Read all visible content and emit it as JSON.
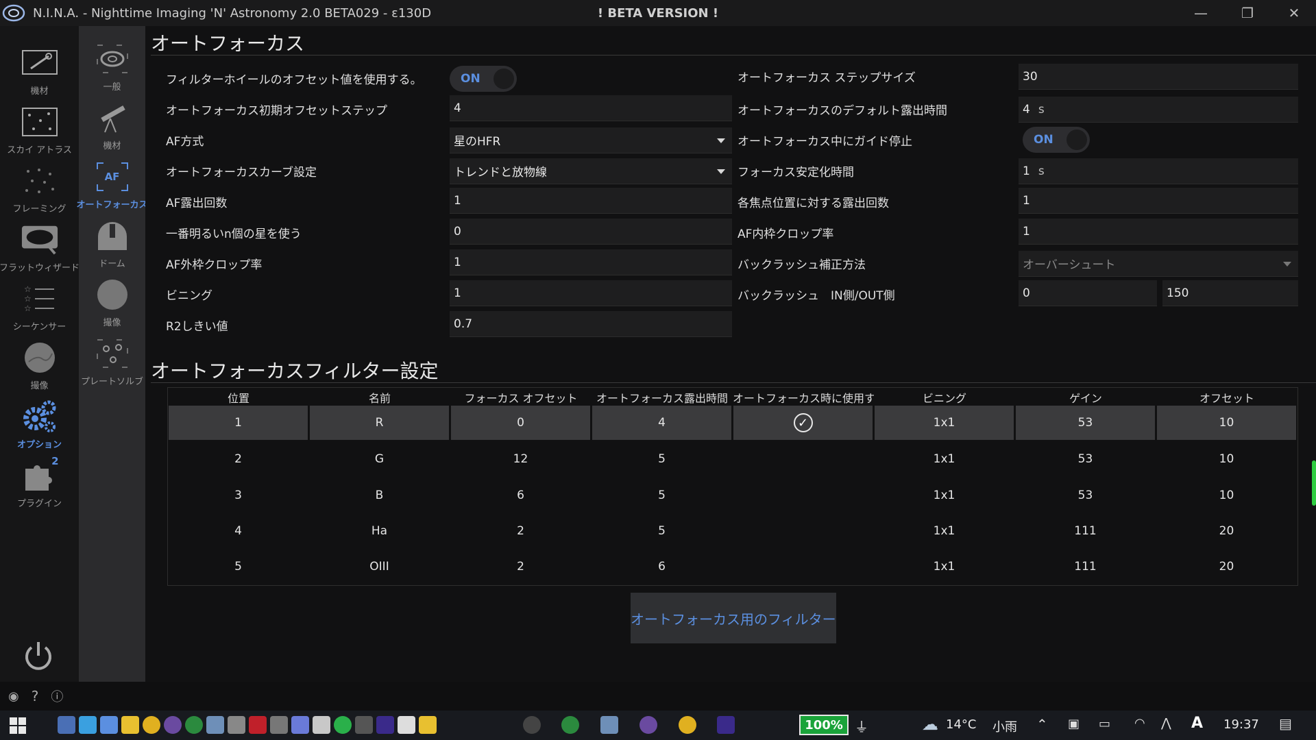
{
  "window": {
    "title": "N.I.N.A. - Nighttime Imaging 'N' Astronomy 2.0 BETA029  -  ε130D",
    "beta_banner": "! BETA VERSION !",
    "minimize": "—",
    "maximize": "❐",
    "close": "✕"
  },
  "nav_primary": [
    {
      "label": "機材",
      "icon": "camera-connect-icon"
    },
    {
      "label": "スカイ アトラス",
      "icon": "sky-atlas-icon"
    },
    {
      "label": "フレーミング",
      "icon": "framing-icon"
    },
    {
      "label": "フラットウィザード",
      "icon": "flat-wizard-icon"
    },
    {
      "label": "シーケンサー",
      "icon": "sequencer-icon"
    },
    {
      "label": "撮像",
      "icon": "imaging-icon"
    },
    {
      "label": "オプション",
      "icon": "gears-icon"
    },
    {
      "label": "プラグイン",
      "icon": "puzzle-icon",
      "badge": "2"
    }
  ],
  "nav_secondary": [
    {
      "label": "一般",
      "icon": "galaxy-icon"
    },
    {
      "label": "機材",
      "icon": "telescope-icon"
    },
    {
      "label": "オートフォーカス",
      "icon": "autofocus-icon",
      "icon_text": "AF"
    },
    {
      "label": "ドーム",
      "icon": "dome-icon"
    },
    {
      "label": "撮像",
      "icon": "imaging-icon"
    },
    {
      "label": "プレートソルブ",
      "icon": "plate-solve-icon"
    }
  ],
  "autofocus": {
    "title": "オートフォーカス",
    "left": {
      "use_filter_offsets_label": "フィルターホイールのオフセット値を使用する。",
      "use_filter_offsets_value": "ON",
      "initial_offset_label": "オートフォーカス初期オフセットステップ",
      "initial_offset_value": "4",
      "method_label": "AF方式",
      "method_value": "星のHFR",
      "curve_label": "オートフォーカスカーブ設定",
      "curve_value": "トレンドと放物線",
      "exposures_label": "AF露出回数",
      "exposures_value": "1",
      "brightest_label": "一番明るいn個の星を使う",
      "brightest_value": "0",
      "outer_crop_label": "AF外枠クロップ率",
      "outer_crop_value": "1",
      "binning_label": "ビニング",
      "binning_value": "1",
      "r2_label": "R2しきい値",
      "r2_value": "0.7"
    },
    "right": {
      "step_size_label": "オートフォーカス ステップサイズ",
      "step_size_value": "30",
      "default_exposure_label": "オートフォーカスのデフォルト露出時間",
      "default_exposure_value": "4",
      "default_exposure_unit": "s",
      "stop_guiding_label": "オートフォーカス中にガイド停止",
      "stop_guiding_value": "ON",
      "settle_label": "フォーカス安定化時間",
      "settle_value": "1",
      "settle_unit": "s",
      "frames_per_point_label": "各焦点位置に対する露出回数",
      "frames_per_point_value": "1",
      "inner_crop_label": "AF内枠クロップ率",
      "inner_crop_value": "1",
      "backlash_method_label": "バックラッシュ補正方法",
      "backlash_method_value": "オーバーシュート",
      "backlash_label": "バックラッシュ　IN側/OUT側",
      "backlash_in": "0",
      "backlash_out": "150"
    }
  },
  "filter_settings": {
    "title": "オートフォーカスフィルター設定",
    "columns": [
      "位置",
      "名前",
      "フォーカス オフセット",
      "オートフォーカス露出時間",
      "オートフォーカス時に使用する",
      "ビニング",
      "ゲイン",
      "オフセット"
    ],
    "rows": [
      {
        "pos": "1",
        "name": "R",
        "offset": "0",
        "exposure": "4",
        "use_af": true,
        "binning": "1x1",
        "gain": "53",
        "cam_offset": "10"
      },
      {
        "pos": "2",
        "name": "G",
        "offset": "12",
        "exposure": "5",
        "use_af": false,
        "binning": "1x1",
        "gain": "53",
        "cam_offset": "10"
      },
      {
        "pos": "3",
        "name": "B",
        "offset": "6",
        "exposure": "5",
        "use_af": false,
        "binning": "1x1",
        "gain": "53",
        "cam_offset": "10"
      },
      {
        "pos": "4",
        "name": "Ha",
        "offset": "2",
        "exposure": "5",
        "use_af": false,
        "binning": "1x1",
        "gain": "111",
        "cam_offset": "20"
      },
      {
        "pos": "5",
        "name": "OIII",
        "offset": "2",
        "exposure": "6",
        "use_af": false,
        "binning": "1x1",
        "gain": "111",
        "cam_offset": "20"
      }
    ],
    "set_af_filter_button": "オートフォーカス用のフィルターとして選択"
  },
  "colors": {
    "accent": "#5b8fe0",
    "battery": "#1aa33a"
  },
  "taskbar": {
    "battery": "100%",
    "weather_temp": "14°C",
    "weather_text": "小雨",
    "time": "19:37"
  }
}
